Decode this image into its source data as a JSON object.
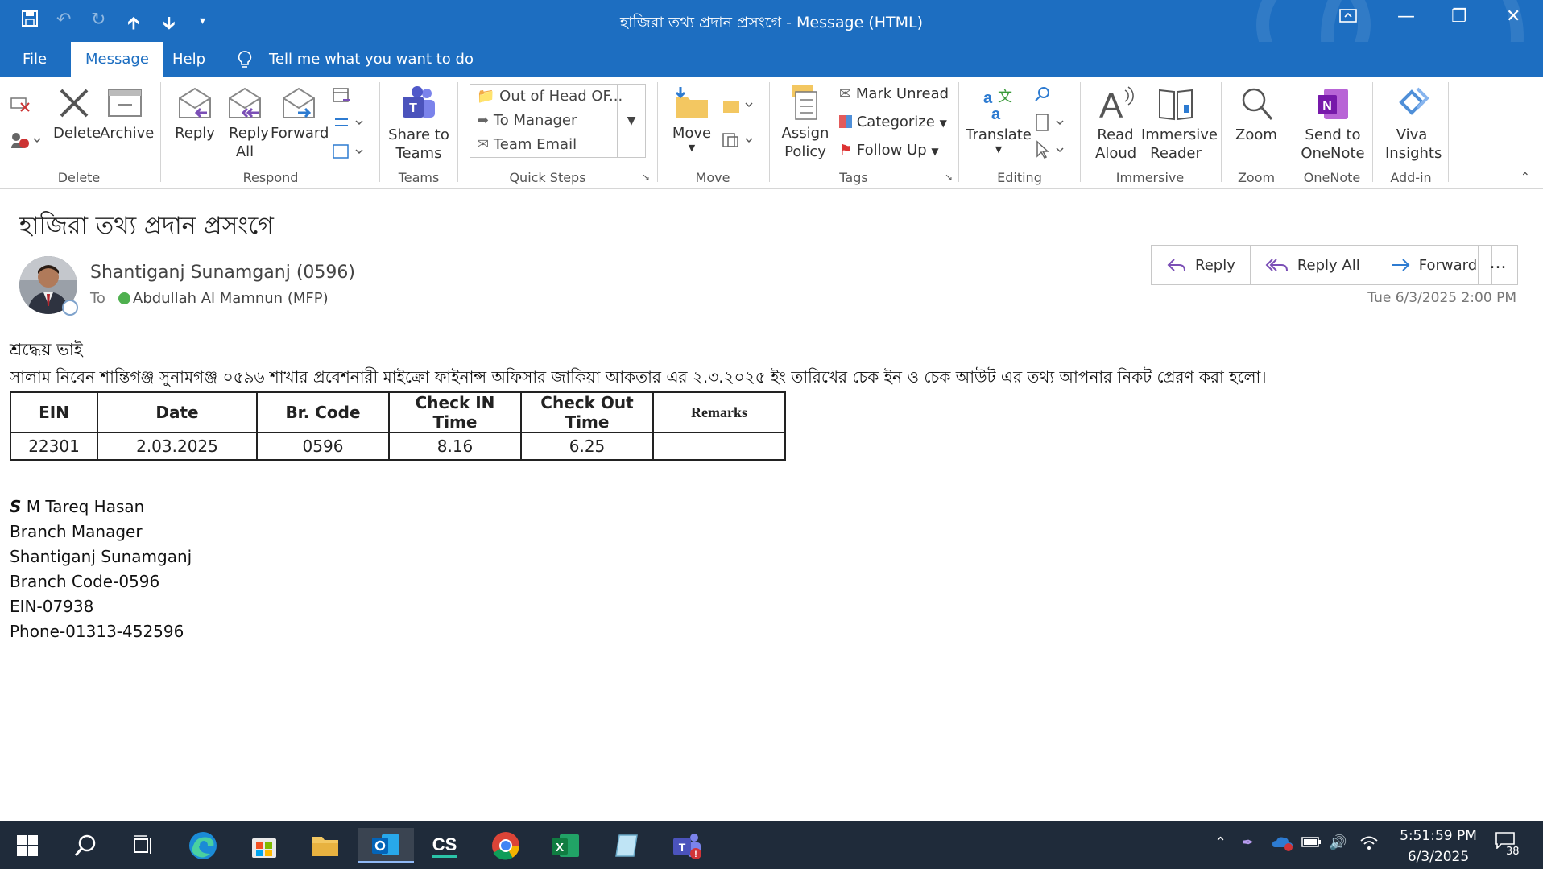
{
  "window": {
    "title": "হাজিরা তথ্য প্রদান প্রসংগে  -  Message (HTML)"
  },
  "tabs": [
    {
      "label": "File"
    },
    {
      "label": "Message"
    },
    {
      "label": "Help"
    }
  ],
  "tell_me": "Tell me what you want to do",
  "ribbon": {
    "delete_label": "Delete",
    "archive_label": "Archive",
    "group_delete": "Delete",
    "reply_label": "Reply",
    "reply_all_label": "Reply All",
    "forward_label": "Forward",
    "group_respond": "Respond",
    "share_teams_label": "Share to Teams",
    "group_teams": "Teams",
    "quick_steps": [
      "Out of Head OF...",
      "To Manager",
      "Team Email"
    ],
    "group_quick_steps": "Quick Steps",
    "move_label": "Move",
    "group_move": "Move",
    "assign_policy_label": "Assign Policy",
    "mark_unread_label": "Mark Unread",
    "categorize_label": "Categorize",
    "follow_up_label": "Follow Up",
    "group_tags": "Tags",
    "translate_label": "Translate",
    "group_editing": "Editing",
    "read_aloud_label": "Read Aloud",
    "immersive_reader_label": "Immersive Reader",
    "group_immersive": "Immersive",
    "zoom_label": "Zoom",
    "group_zoom": "Zoom",
    "send_onenote_label": "Send to OneNote",
    "group_onenote": "OneNote",
    "viva_label": "Viva Insights",
    "group_addin": "Add-in"
  },
  "message": {
    "subject": "হাজিরা তথ্য প্রদান প্রসংগে",
    "sender": "Shantiganj Sunamganj (0596)",
    "to_label": "To",
    "recipient": "Abdullah Al Mamnun (MFP)",
    "date": "Tue 6/3/2025 2:00 PM",
    "actions": {
      "reply": "Reply",
      "reply_all": "Reply All",
      "forward": "Forward",
      "more": "..."
    },
    "greeting": "শ্রদ্ধেয়  ভাই",
    "body_line": "সালাম নিবেন শান্তিগঞ্জ সুনামগঞ্জ ০৫৯৬ শাখার প্রবেশনারী মাইক্রো ফাইনান্স অফিসার জাকিয়া আকতার এর ২.৩.২০২৫ ইং তারিখের চেক ইন ও চেক আউট এর তথ্য আপনার নিকট প্রেরণ করা হলো।",
    "table": {
      "headers": [
        "EIN",
        "Date",
        "Br. Code",
        "Check IN Time",
        "Check Out Time",
        "Remarks"
      ],
      "row": [
        "22301",
        "2.03.2025",
        "0596",
        "8.16",
        "6.25",
        ""
      ]
    },
    "signature": {
      "initial": "S",
      "name_rest": " M Tareq Hasan",
      "lines": [
        "Branch Manager",
        "Shantiganj Sunamganj",
        "Branch Code-0596",
        "EIN-07938",
        "Phone-01313-452596"
      ]
    }
  },
  "taskbar": {
    "clock_time": "5:51:59 PM",
    "clock_date": "6/3/2025",
    "notification_count": "38",
    "cs_label": "CS"
  }
}
